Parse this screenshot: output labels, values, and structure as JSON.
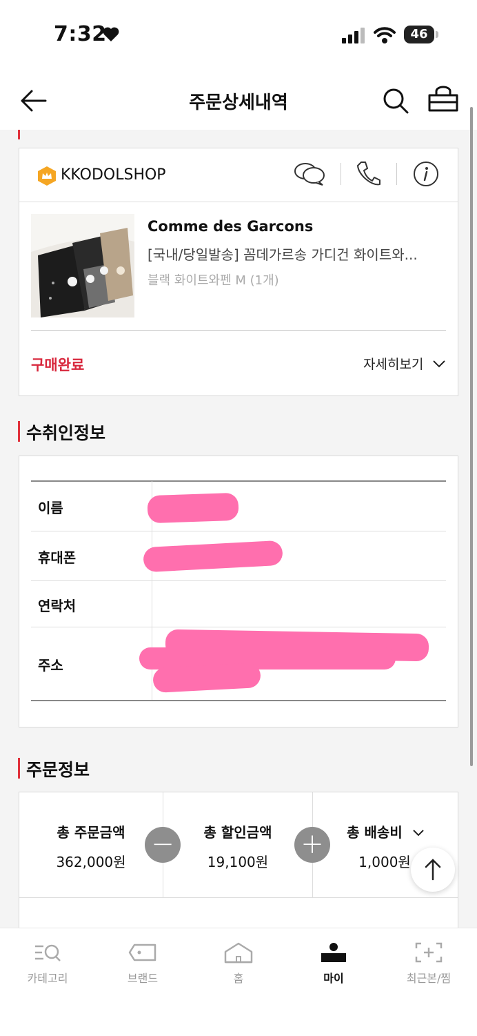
{
  "status_bar": {
    "time": "7:32",
    "battery": "46"
  },
  "header": {
    "title": "주문상세내역"
  },
  "seller": {
    "name": "KKODOLSHOP",
    "product": {
      "brand": "Comme des Garcons",
      "name": "[국내/당일발송] 꼼데가르송 가디건 화이트와...",
      "option": "블랙 화이트와펜 M (1개)"
    },
    "status": "구매완료",
    "detail_label": "자세히보기"
  },
  "recipient": {
    "title": "수취인정보",
    "rows": [
      {
        "label": "이름"
      },
      {
        "label": "휴대폰"
      },
      {
        "label": "연락처"
      },
      {
        "label": "주소"
      }
    ]
  },
  "order": {
    "title": "주문정보",
    "items": [
      {
        "label": "총 주문금액",
        "value": "362,000원"
      },
      {
        "label": "총 할인금액",
        "value": "19,100원"
      },
      {
        "label": "총 배송비",
        "value": "1,000원"
      }
    ]
  },
  "nav": [
    {
      "label": "카테고리",
      "icon": "category-search-icon"
    },
    {
      "label": "브랜드",
      "icon": "tag-icon"
    },
    {
      "label": "홈",
      "icon": "home-icon"
    },
    {
      "label": "마이",
      "icon": "person-icon",
      "active": true
    },
    {
      "label": "최근본/찜",
      "icon": "recent-icon"
    }
  ],
  "colors": {
    "accent": "#d8273c",
    "redaction": "#ff6fae",
    "active_nav": "#111111"
  }
}
